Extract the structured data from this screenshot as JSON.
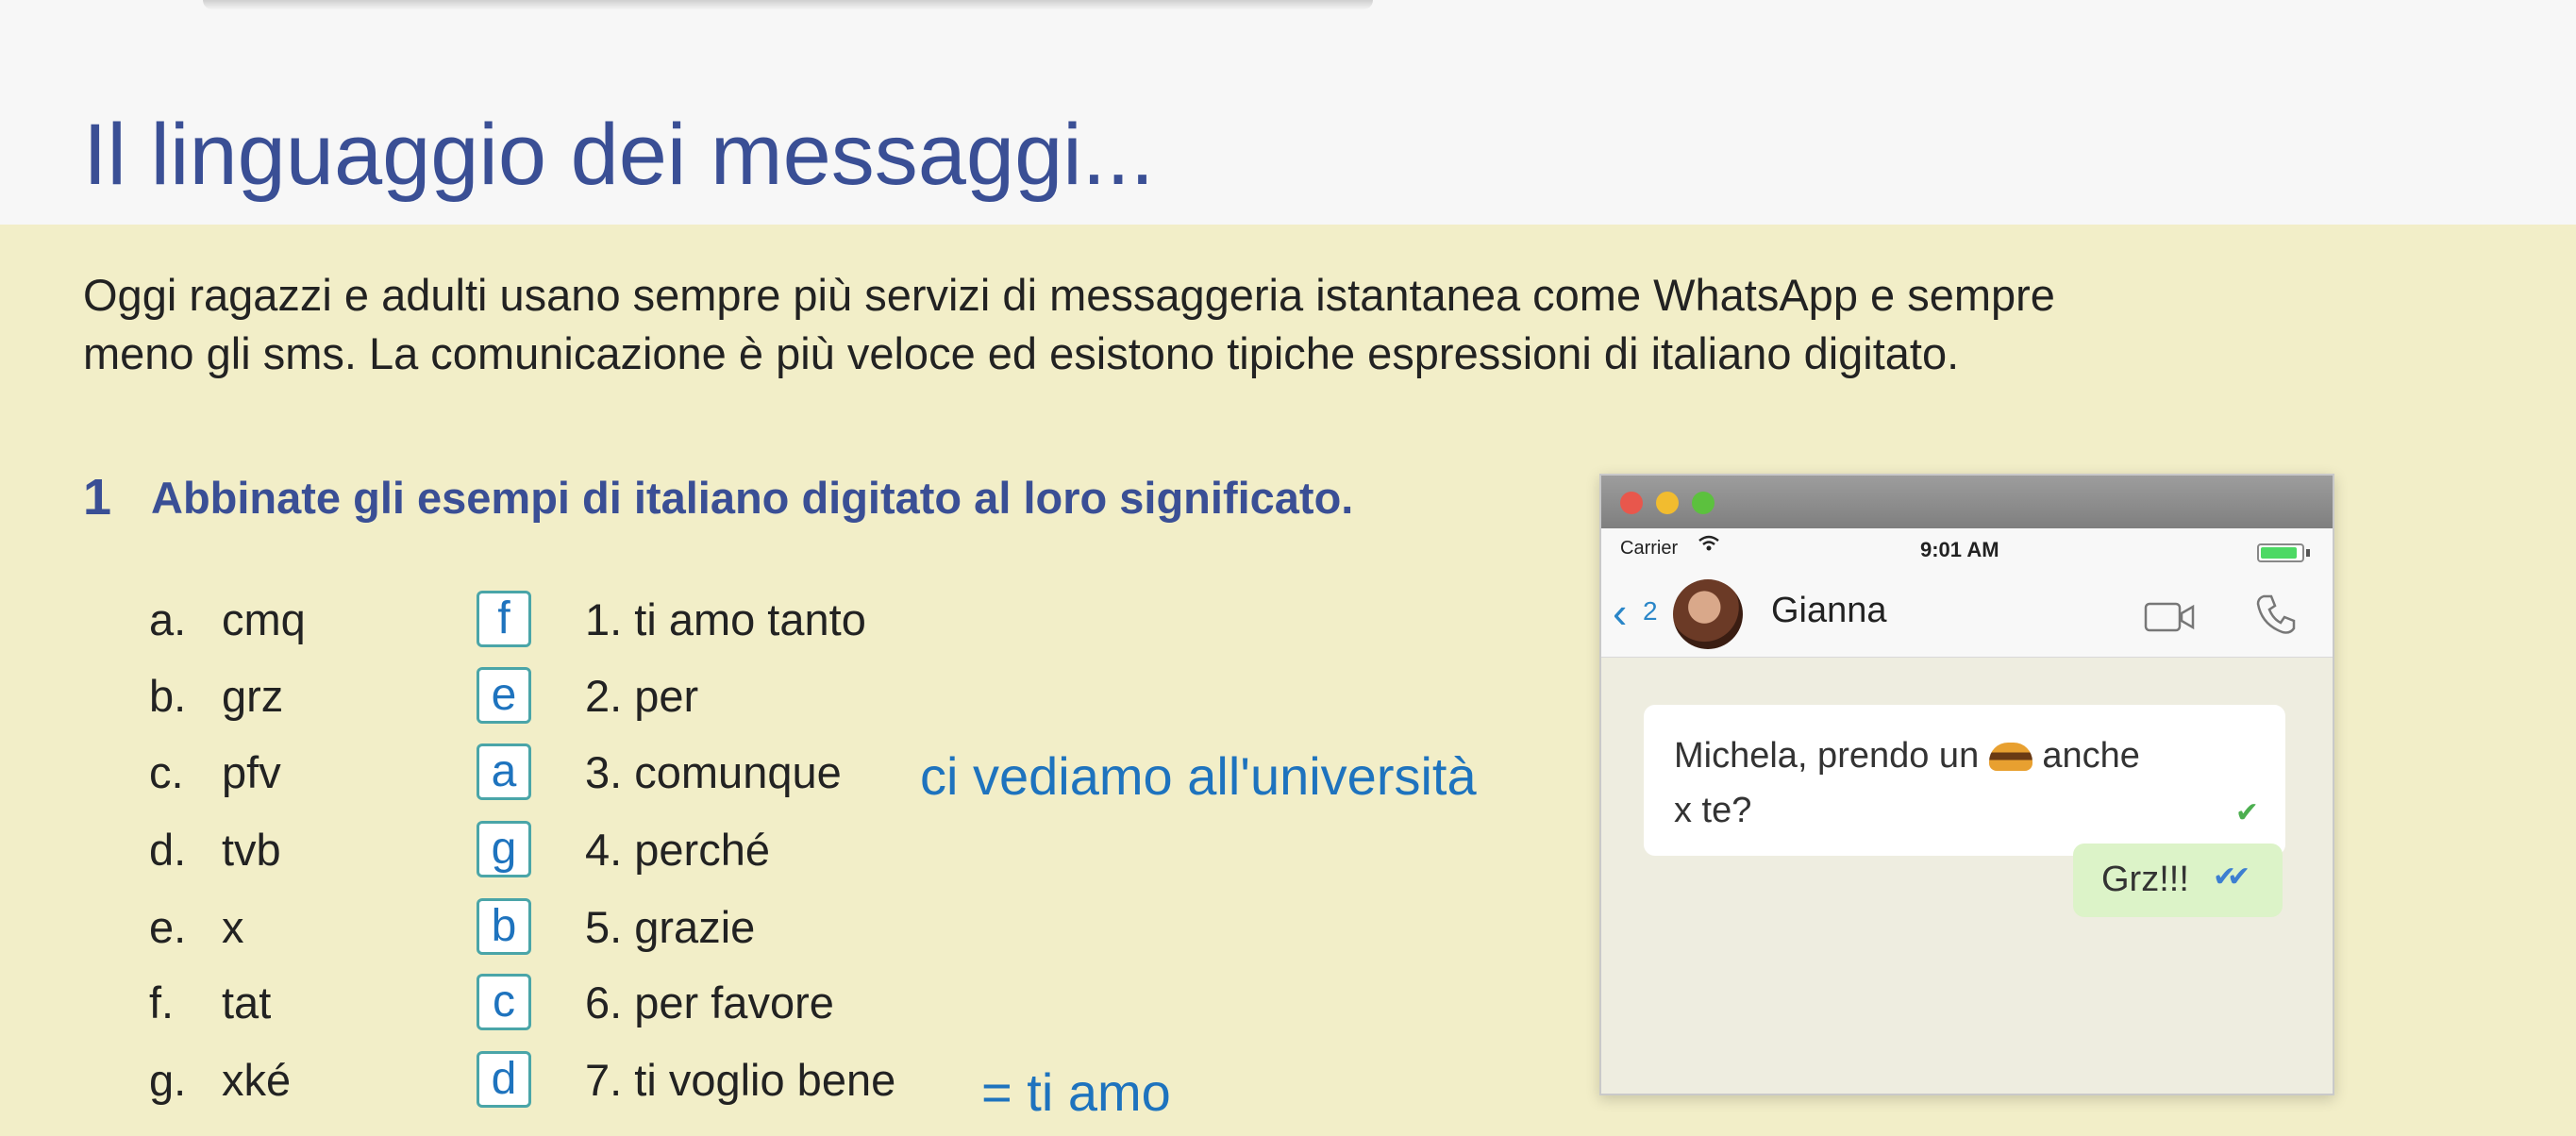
{
  "page_title": "Il linguaggio dei messaggi...",
  "intro_line1": "Oggi ragazzi e adulti usano sempre più servizi di messaggeria istantanea come WhatsApp e sempre",
  "intro_line2": "meno gli sms. La comunicazione è più veloce ed esistono tipiche espressioni di italiano digitato.",
  "exercise": {
    "number": "1",
    "instruction": "Abbinate gli esempi di italiano digitato al loro significato.",
    "rows": [
      {
        "letter": "a.",
        "abbr": "cmq",
        "answer": "f",
        "num": "1.",
        "meaning": "ti amo tanto"
      },
      {
        "letter": "b.",
        "abbr": "grz",
        "answer": "e",
        "num": "2.",
        "meaning": "per"
      },
      {
        "letter": "c.",
        "abbr": "pfv",
        "answer": "a",
        "num": "3.",
        "meaning": "comunque"
      },
      {
        "letter": "d.",
        "abbr": "tvb",
        "answer": "g",
        "num": "4.",
        "meaning": "perché"
      },
      {
        "letter": "e.",
        "abbr": "x",
        "answer": "b",
        "num": "5.",
        "meaning": "grazie"
      },
      {
        "letter": "f.",
        "abbr": "tat",
        "answer": "c",
        "num": "6.",
        "meaning": "per favore"
      },
      {
        "letter": "g.",
        "abbr": "xké",
        "answer": "d",
        "num": "7.",
        "meaning": "ti voglio bene"
      }
    ]
  },
  "annotations": {
    "note_row3": "ci vediamo all'università",
    "note_row7": "= ti amo"
  },
  "phone": {
    "carrier": "Carrier",
    "time": "9:01 AM",
    "back_count": "2",
    "contact_name": "Gianna",
    "incoming_before_emoji": "Michela, prendo un",
    "incoming_after_emoji": "anche",
    "incoming_line2": "x te?",
    "outgoing": "Grz!!!"
  },
  "colors": {
    "title": "#3a4f95",
    "panel_bg": "#f2eec8",
    "handwriting": "#1e73be",
    "box_border": "#4aa5a8"
  }
}
